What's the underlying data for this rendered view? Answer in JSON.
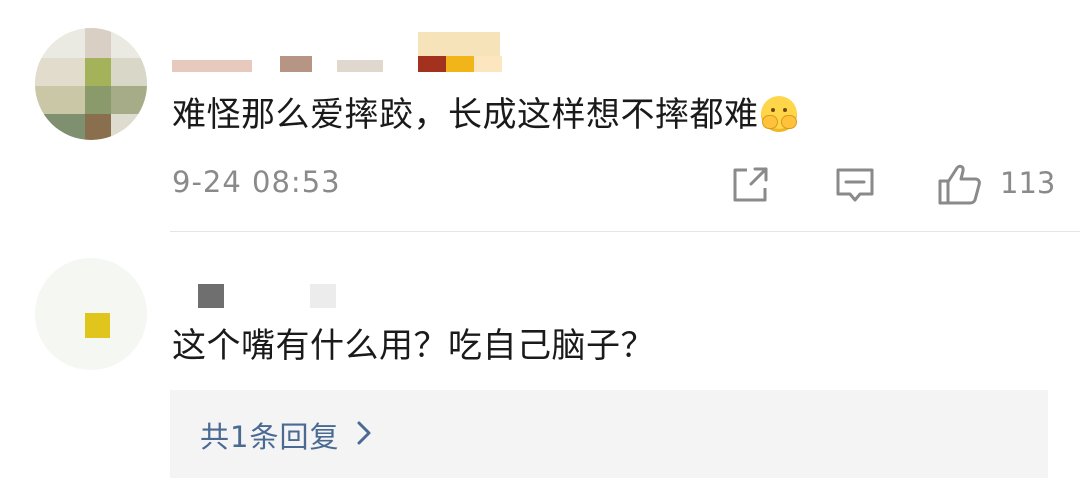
{
  "comments": [
    {
      "text": "难怪那么爱摔跤，长成这样想不摔都难",
      "emoji": "hugging-face-emoji",
      "timestamp": "9-24 08:53",
      "likes": "113"
    },
    {
      "text": "这个嘴有什么用？吃自己脑子？",
      "reply_summary": "共1条回复"
    }
  ],
  "colors": {
    "link": "#4a6a93",
    "meta": "#8a8a8a",
    "reply_bg": "#f4f4f4"
  }
}
